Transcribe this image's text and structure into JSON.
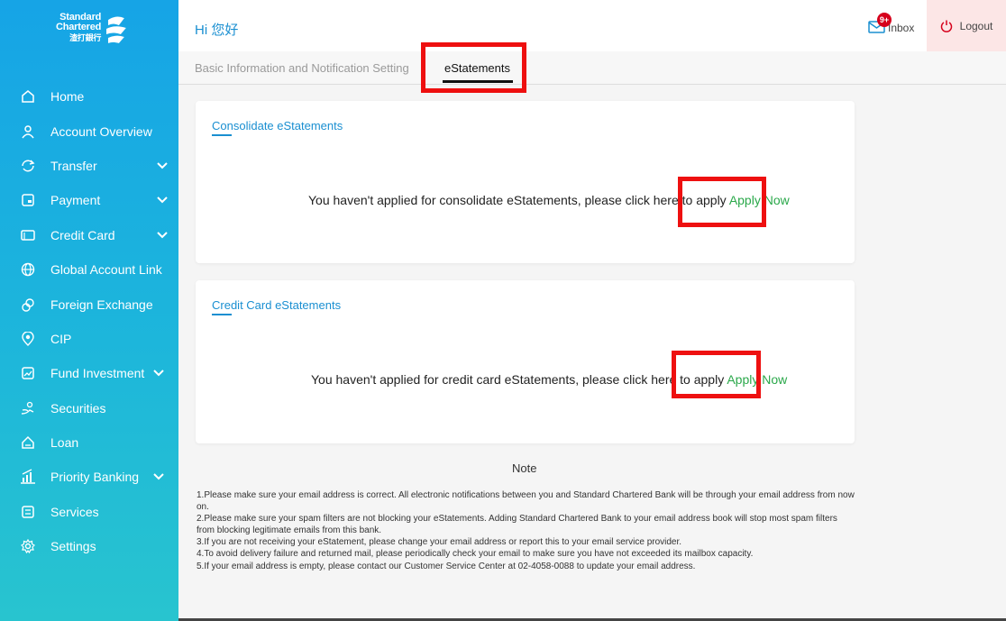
{
  "brand": {
    "line1": "Standard",
    "line2": "Chartered",
    "line3": "渣打銀行"
  },
  "header": {
    "greeting": "Hi 您好",
    "inbox_label": "Inbox",
    "inbox_badge": "9+",
    "logout_label": "Logout"
  },
  "sidebar": {
    "items": [
      {
        "label": "Home",
        "icon": "home-icon",
        "expandable": false
      },
      {
        "label": "Account Overview",
        "icon": "user-icon",
        "expandable": false
      },
      {
        "label": "Transfer",
        "icon": "transfer-icon",
        "expandable": true
      },
      {
        "label": "Payment",
        "icon": "payment-icon",
        "expandable": true
      },
      {
        "label": "Credit Card",
        "icon": "credit-card-icon",
        "expandable": true
      },
      {
        "label": "Global Account Link",
        "icon": "globe-icon",
        "expandable": false
      },
      {
        "label": "Foreign Exchange",
        "icon": "exchange-icon",
        "expandable": false
      },
      {
        "label": "CIP",
        "icon": "cip-icon",
        "expandable": false
      },
      {
        "label": "Fund Investment",
        "icon": "fund-icon",
        "expandable": true
      },
      {
        "label": "Securities",
        "icon": "securities-icon",
        "expandable": false
      },
      {
        "label": "Loan",
        "icon": "loan-icon",
        "expandable": false
      },
      {
        "label": "Priority Banking",
        "icon": "priority-icon",
        "expandable": true
      },
      {
        "label": "Services",
        "icon": "services-icon",
        "expandable": false
      },
      {
        "label": "Settings",
        "icon": "gear-icon",
        "expandable": false
      }
    ]
  },
  "tabs": {
    "basic": "Basic Information and Notification Setting",
    "estatements": "eStatements",
    "active": "eStatements"
  },
  "cards": {
    "consolidate": {
      "title": "Consolidate eStatements",
      "message": "You haven't applied for consolidate eStatements, please click here to apply",
      "apply_label": "Apply Now"
    },
    "credit_card": {
      "title": "Credit Card eStatements",
      "message": "You haven't applied for credit card eStatements, please click here to apply",
      "apply_label": "Apply Now"
    }
  },
  "note": {
    "title": "Note",
    "lines": [
      "1.Please make sure your email address is correct. All electronic notifications between you and Standard Chartered Bank will be through your email address from now on.",
      "2.Please make sure your spam filters are not blocking your eStatements. Adding Standard Chartered Bank to your email address book will stop most spam filters from blocking legitimate emails from this bank.",
      "3.If you are not receiving your eStatement, please change your email address or report this to your email service provider.",
      "4.To avoid delivery failure and returned mail, please periodically check your email to make sure you have not exceeded its mailbox capacity.",
      "5.If your email address is empty, please contact our Customer Service Center at 02-4058-0088 to update your email address."
    ]
  },
  "colors": {
    "sidebar_top": "#16a4e6",
    "sidebar_bottom": "#28c4cf",
    "accent_blue": "#1a8fd1",
    "apply_green": "#2aa84a",
    "highlight_red": "#ee1010"
  }
}
